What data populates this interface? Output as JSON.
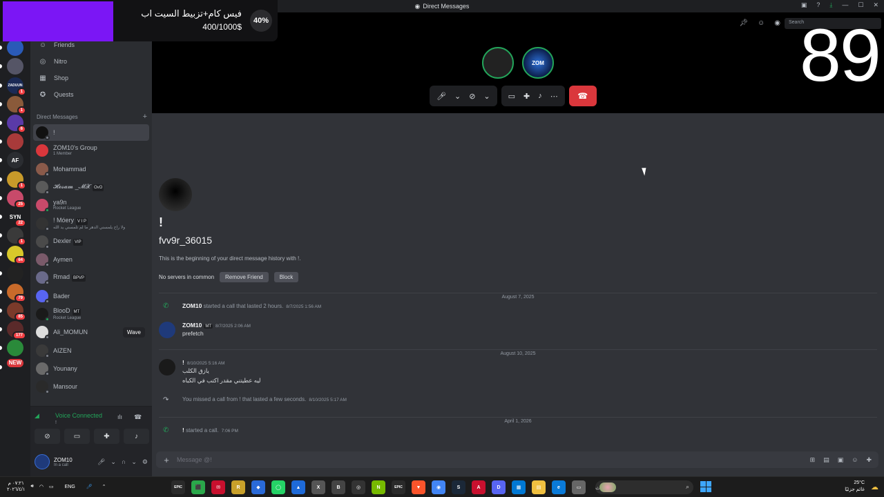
{
  "window": {
    "title": "Direct Messages"
  },
  "promo": {
    "title": "فيس كام+تزبيط السيت اب",
    "amount": "400/1000$",
    "percent": "40%"
  },
  "overlay_number": "89",
  "search": {
    "placeholder": "Search"
  },
  "servers": [
    {
      "label": "",
      "badge": "",
      "color": "#3a4a6b"
    },
    {
      "label": "",
      "badge": "",
      "color": "#2a5ab8"
    },
    {
      "label": "",
      "badge": "",
      "color": "#556"
    },
    {
      "label": "ZADUUN",
      "badge": "1",
      "color": "#1b2a55"
    },
    {
      "label": "",
      "badge": "1",
      "color": "#8a5a3a"
    },
    {
      "label": "",
      "badge": "6",
      "color": "#5a3aa8"
    },
    {
      "label": "",
      "badge": "",
      "color": "#a83a3a"
    },
    {
      "label": "AF",
      "badge": "",
      "color": "#2b2d31"
    },
    {
      "label": "",
      "badge": "1",
      "color": "#c89a2a"
    },
    {
      "label": "",
      "badge": "25",
      "color": "#c84a6a"
    },
    {
      "label": "SYN",
      "badge": "22",
      "color": "#1e1f22"
    },
    {
      "label": "",
      "badge": "1",
      "color": "#3a3a3a"
    },
    {
      "label": "",
      "badge": "64",
      "color": "#d8c82a"
    },
    {
      "label": "",
      "badge": "",
      "color": "#222"
    },
    {
      "label": "",
      "badge": "79",
      "color": "#c86a2a"
    },
    {
      "label": "",
      "badge": "85",
      "color": "#7a3a2a"
    },
    {
      "label": "",
      "badge": "177",
      "color": "#5a2a2a"
    },
    {
      "label": "",
      "badge": "",
      "color": "#2a8a3a"
    },
    {
      "label": "NEW",
      "badge": "",
      "color": "#da373c"
    }
  ],
  "nav": {
    "friends": "Friends",
    "nitro": "Nitro",
    "shop": "Shop",
    "quests": "Quests"
  },
  "dm_header": {
    "label": "Direct Messages",
    "add": "+"
  },
  "dms": [
    {
      "name": "!",
      "sub": "",
      "tag": "",
      "color": "#111",
      "status": "#80848e"
    },
    {
      "name": "ZOM10's Group",
      "sub": "1 Member",
      "tag": "",
      "color": "#da373c",
      "status": ""
    },
    {
      "name": "Mohammad",
      "sub": "",
      "tag": "",
      "color": "#8a5a4a",
      "status": "#80848e"
    },
    {
      "name": "𝓗𝓮𝓼𝓪𝓶 _𝓜𝓧",
      "sub": "",
      "tag": "OvO",
      "color": "#5a5a5a",
      "status": "#80848e"
    },
    {
      "name": "ya9n",
      "sub": "Rocket League",
      "tag": "",
      "color": "#c84a6a",
      "status": "#23a55a"
    },
    {
      "name": "! Móery",
      "sub": "ولا راح يلمسني الدهر ما لم تلمسني يد الله",
      "tag": "V I P",
      "color": "#333",
      "status": "#80848e"
    },
    {
      "name": "Dexler",
      "sub": "",
      "tag": "VIP",
      "color": "#4a4a4a",
      "status": "#80848e"
    },
    {
      "name": "Aymen",
      "sub": "",
      "tag": "",
      "color": "#7a5a6a",
      "status": "#80848e"
    },
    {
      "name": "Rmad",
      "sub": "",
      "tag": "BPVP",
      "color": "#6a6a8a",
      "status": "#80848e"
    },
    {
      "name": "Bader",
      "sub": "",
      "tag": "",
      "color": "#5865f2",
      "status": "#80848e"
    },
    {
      "name": "BlooD",
      "sub": "Rocket League",
      "tag": "MT",
      "color": "#1a1a1a",
      "status": "#23a55a"
    },
    {
      "name": "Ali_MOMUN",
      "sub": "",
      "tag": "",
      "color": "#ddd",
      "status": "#80848e",
      "wave": "Wave"
    },
    {
      "name": "AIZEN",
      "sub": "",
      "tag": "",
      "color": "#3a3a3a",
      "status": "#80848e"
    },
    {
      "name": "Younany",
      "sub": "",
      "tag": "",
      "color": "#6a6a6a",
      "status": "#80848e"
    },
    {
      "name": "Mansour",
      "sub": "",
      "tag": "",
      "color": "#2a2a2a",
      "status": "#80848e"
    }
  ],
  "voice": {
    "status": "Voice Connected",
    "sub": "!"
  },
  "user": {
    "name": "ZOM10",
    "status": "In a call"
  },
  "call": {
    "avatar2_label": "ZOM"
  },
  "profile": {
    "display_name": "!",
    "username": "fvv9r_36015",
    "description": "This is the beginning of your direct message history with !.",
    "no_servers": "No servers in common",
    "remove_friend": "Remove Friend",
    "block": "Block"
  },
  "messages": [
    {
      "kind": "divider",
      "text": "August 7, 2025"
    },
    {
      "kind": "call",
      "icon": "✆",
      "icon_color": "#23a55a",
      "author": "ZOM10",
      "text": "started a call that lasted 2 hours.",
      "ts": "8/7/2025 1:56 AM"
    },
    {
      "kind": "msg",
      "author": "ZOM10",
      "tag": "MT",
      "ts": "8/7/2025 2:06 AM",
      "lines": [
        "prefetch"
      ],
      "avatar": "#1f3a7a"
    },
    {
      "kind": "divider",
      "text": "August 10, 2025"
    },
    {
      "kind": "msg",
      "author": "!",
      "tag": "",
      "ts": "8/10/2025 5:16 AM",
      "lines": [
        "يازق الكلب",
        "ليه عطيتني مقدر اكتب في الكباه"
      ],
      "avatar": "#1a1a1a"
    },
    {
      "kind": "call",
      "icon": "↷",
      "icon_color": "#b5bac1",
      "author": "",
      "text": "You missed a call from ! that lasted a few seconds.",
      "ts": "8/10/2025 5:17 AM"
    },
    {
      "kind": "divider",
      "text": "April 1, 2026"
    },
    {
      "kind": "call",
      "icon": "✆",
      "icon_color": "#23a55a",
      "author": "!",
      "text": "started a call.",
      "ts": "7:06 PM"
    }
  ],
  "composer": {
    "placeholder": "Message @!"
  },
  "taskbar": {
    "time": "٠٧:٢١ م",
    "date": "٢٠٢٦/٤/١",
    "lang": "ENG",
    "search_text": "بحث",
    "weather_temp": "25°C",
    "weather_desc": "غائم جزئيًا",
    "apps": [
      {
        "label": "EPIC",
        "color": "#2a2a2a"
      },
      {
        "label": "⬛",
        "color": "#2aa84a"
      },
      {
        "label": "✉",
        "color": "#c8102e"
      },
      {
        "label": "R",
        "color": "#c8a02a"
      },
      {
        "label": "◆",
        "color": "#2a6ad8"
      },
      {
        "label": "◯",
        "color": "#25d366"
      },
      {
        "label": "▲",
        "color": "#1e6ad8"
      },
      {
        "label": "X",
        "color": "#555"
      },
      {
        "label": "B",
        "color": "#444"
      },
      {
        "label": "◎",
        "color": "#333"
      },
      {
        "label": "N",
        "color": "#76b900"
      },
      {
        "label": "EPIC",
        "color": "#2a2a2a"
      },
      {
        "label": "▼",
        "color": "#fb542b"
      },
      {
        "label": "◉",
        "color": "#4285f4"
      },
      {
        "label": "S",
        "color": "#1b2838"
      },
      {
        "label": "A",
        "color": "#c8102e"
      },
      {
        "label": "D",
        "color": "#5865f2"
      },
      {
        "label": "▦",
        "color": "#0078d4"
      },
      {
        "label": "▤",
        "color": "#f0c040"
      },
      {
        "label": "e",
        "color": "#0a7ad8"
      },
      {
        "label": "▭",
        "color": "#666"
      }
    ]
  }
}
